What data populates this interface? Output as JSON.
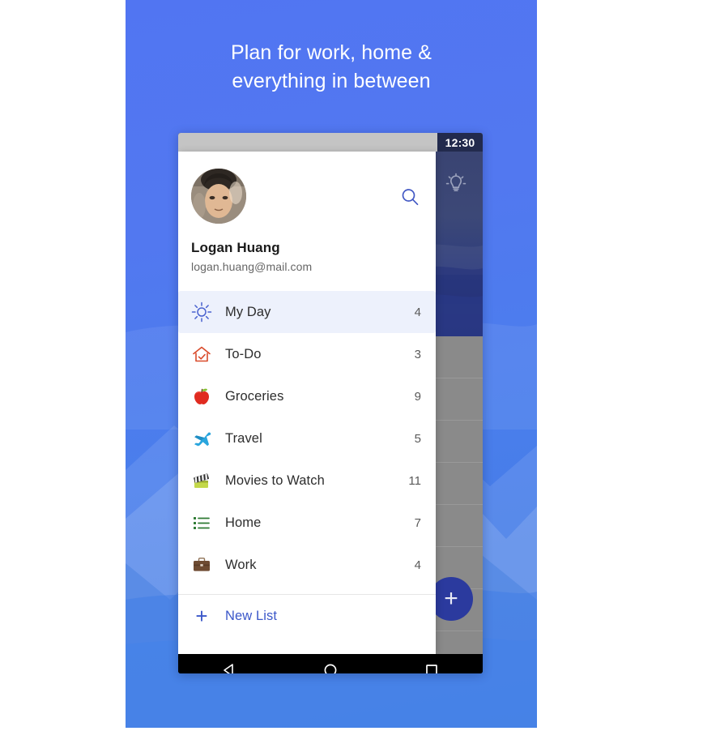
{
  "promo": {
    "headline": "Plan for work, home &\neverything in between",
    "background_color_top": "#5175F2",
    "background_color_bottom": "#3F7AE0"
  },
  "status_bar": {
    "clock": "12:30",
    "icons": [
      "wifi-icon",
      "signal-icon",
      "battery-icon"
    ],
    "bar_color": "#C4C4C4",
    "clock_bg_color": "#222A4D"
  },
  "drawer": {
    "profile": {
      "name": "Logan Huang",
      "email": "logan.huang@mail.com",
      "avatar": "user-photo"
    },
    "search_icon": "search-icon",
    "accent_color": "#3B57C9",
    "active_row_color": "#EDF1FC",
    "lists": [
      {
        "label": "My Day",
        "count": "4",
        "icon": "sun-icon",
        "active": true
      },
      {
        "label": "To-Do",
        "count": "3",
        "icon": "house-check-icon",
        "active": false
      },
      {
        "label": "Groceries",
        "count": "9",
        "icon": "apple-icon",
        "active": false
      },
      {
        "label": "Travel",
        "count": "5",
        "icon": "airplane-icon",
        "active": false
      },
      {
        "label": "Movies to Watch",
        "count": "11",
        "icon": "clapperboard-icon",
        "active": false
      },
      {
        "label": "Home",
        "count": "7",
        "icon": "bullet-list-icon",
        "active": false
      },
      {
        "label": "Work",
        "count": "4",
        "icon": "briefcase-icon",
        "active": false
      }
    ],
    "new_list": {
      "label": "New List",
      "icon": "plus-icon"
    }
  },
  "background_app": {
    "header_icon": "lightbulb-icon",
    "header_color": "#2C3B7E",
    "fab": {
      "icon": "plus-icon",
      "color": "#2B3A9E"
    }
  },
  "nav_bar": {
    "buttons": [
      {
        "name": "back-button",
        "icon": "triangle-back-icon"
      },
      {
        "name": "home-button",
        "icon": "circle-home-icon"
      },
      {
        "name": "recents-button",
        "icon": "square-recents-icon"
      }
    ]
  }
}
